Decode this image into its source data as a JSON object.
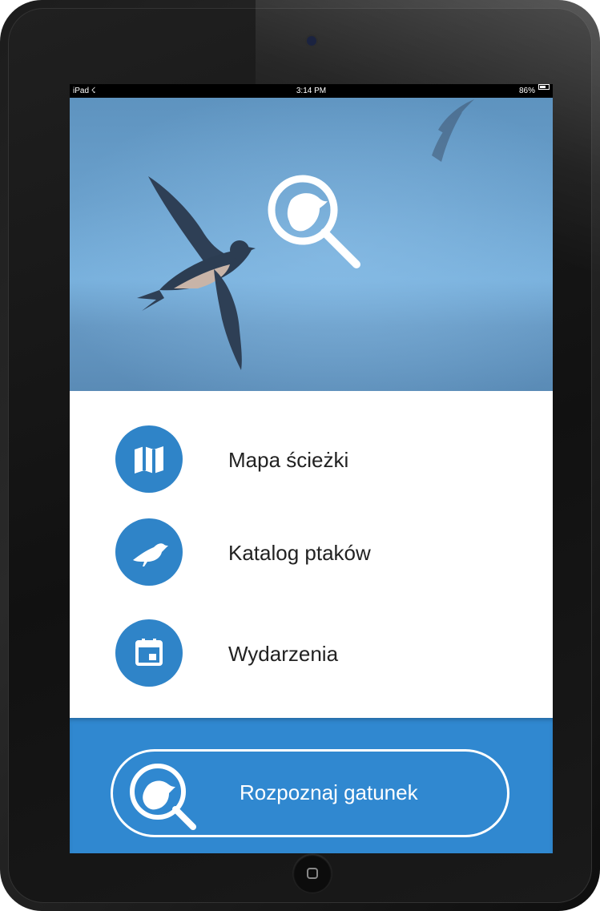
{
  "status_bar": {
    "carrier": "iPad ☇",
    "time": "3:14 PM",
    "battery": "86%"
  },
  "hero": {
    "logo_icon": "bird-magnifier-icon",
    "image": "swallow-photo"
  },
  "menu": {
    "items": [
      {
        "label": "Mapa ścieżki",
        "icon": "map-icon"
      },
      {
        "label": "Katalog ptaków",
        "icon": "bird-icon"
      },
      {
        "label": "Wydarzenia",
        "icon": "calendar-icon"
      }
    ]
  },
  "recognize": {
    "label": "Rozpoznaj gatunek",
    "icon": "bird-magnifier-icon"
  },
  "colors": {
    "accent": "#2f84c8",
    "bottom_bar": "#3088d0",
    "sky": "#6aa0cc"
  }
}
